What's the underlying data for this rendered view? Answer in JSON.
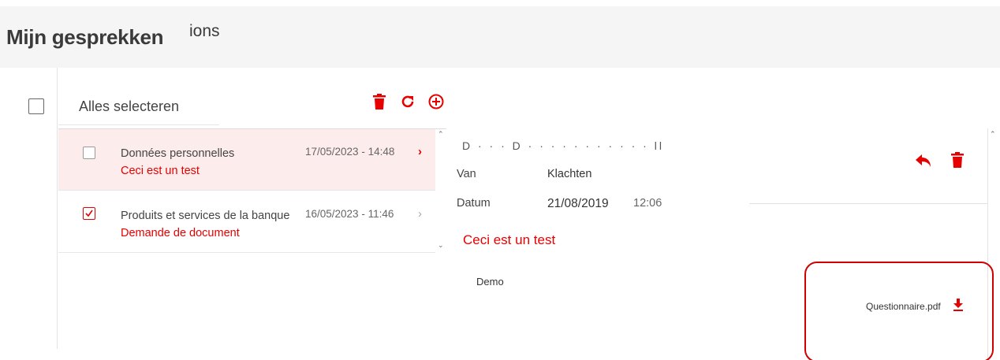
{
  "page": {
    "title": "Mijn gesprekken",
    "title_overlap": "ions"
  },
  "toolbar": {
    "select_all_label": "Alles selecteren",
    "icons": [
      "trash-icon",
      "refresh-icon",
      "add-circle-icon"
    ],
    "accent_color": "#e60000"
  },
  "conversations": [
    {
      "subject": "Données personnelles",
      "preview": "Ceci est un test",
      "date": "17/05/2023 - 14:48",
      "checked": false,
      "active": true
    },
    {
      "subject": "Produits et services de la banque",
      "preview": "Demande de document",
      "date": "16/05/2023 - 11:46",
      "checked": true,
      "active": false
    }
  ],
  "detail": {
    "header_cut": "D  · · ·        D  ·  ·  ·    ·  · · · · · · · ll",
    "from_label": "Van",
    "from_value": "Klachten",
    "date_label": "Datum",
    "date_value": "21/08/2019",
    "time_value": "12:06",
    "subject": "Ceci est un test",
    "body": "Demo",
    "actions": [
      "reply-icon",
      "trash-icon"
    ]
  },
  "attachment": {
    "filename": "Questionnaire.pdf",
    "icon": "download-icon"
  }
}
